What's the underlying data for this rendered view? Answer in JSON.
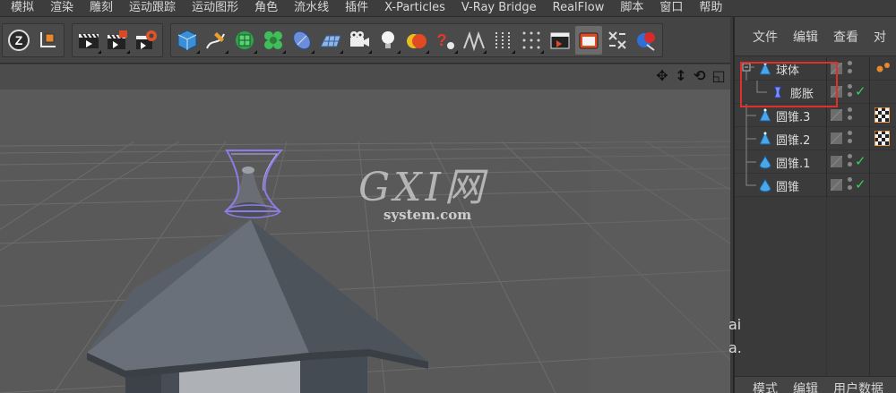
{
  "menu": {
    "items": [
      "模拟",
      "渲染",
      "雕刻",
      "运动跟踪",
      "运动图形",
      "角色",
      "流水线",
      "插件",
      "X-Particles",
      "V-Ray Bridge",
      "RealFlow",
      "脚本",
      "窗口",
      "帮助"
    ]
  },
  "toolbar": {
    "groups": [
      {
        "name": "axis",
        "icons": [
          "z-axis-icon",
          "coordinate-system-icon"
        ]
      },
      {
        "name": "render",
        "icons": [
          "render-view-icon",
          "render-picture-viewer-icon",
          "render-settings-icon"
        ]
      },
      {
        "name": "objects",
        "icons": [
          "cube-icon",
          "pen-spline-icon",
          "subdivision-surface-icon",
          "cloner-icon",
          "deformer-icon",
          "floor-icon",
          "camera-icon",
          "light-icon",
          "material-sphere-icon",
          "help-tag-icon",
          "symmetry-icon",
          "array-icon",
          "grid-dots-icon",
          "clapper-icon",
          "folder-icon",
          "xpresso-icon",
          "vray-icon"
        ]
      }
    ],
    "active_icon": "folder-icon"
  },
  "viewport": {
    "nav_icons": [
      "move-view-icon",
      "scale-view-icon",
      "rotate-view-icon",
      "layout-icon"
    ],
    "watermark": {
      "logo": "GXI网",
      "site": "system.com"
    },
    "colors": {
      "background": "#5b5b5b",
      "grid": "#6b6b6b",
      "roof": "#4a5059",
      "selection": "#8d7ce6"
    }
  },
  "object_manager": {
    "tabs": [
      "文件",
      "编辑",
      "查看",
      "对"
    ],
    "bottom_tabs": [
      "模式",
      "编辑",
      "用户数据"
    ],
    "objects": [
      {
        "name": "球体",
        "icon": "cone-object-icon",
        "level": 0,
        "expanded": true,
        "checked": false,
        "tag": "material-tag-icon"
      },
      {
        "name": "膨胀",
        "icon": "bulge-deformer-icon",
        "level": 1,
        "checked": true,
        "tag": ""
      },
      {
        "name": "圆锥.3",
        "icon": "cone-object-icon",
        "level": 0,
        "checked": false,
        "tag": "checker-material-icon"
      },
      {
        "name": "圆锥.2",
        "icon": "cone-object-icon",
        "level": 0,
        "checked": false,
        "tag": "checker-material-icon"
      },
      {
        "name": "圆锥.1",
        "icon": "cone-object-icon",
        "level": 0,
        "checked": true,
        "tag": ""
      },
      {
        "name": "圆锥",
        "icon": "cone-object-icon",
        "level": 0,
        "checked": true,
        "tag": ""
      }
    ],
    "highlight_color": "#e0302c",
    "side_fragment": "ai\na."
  }
}
